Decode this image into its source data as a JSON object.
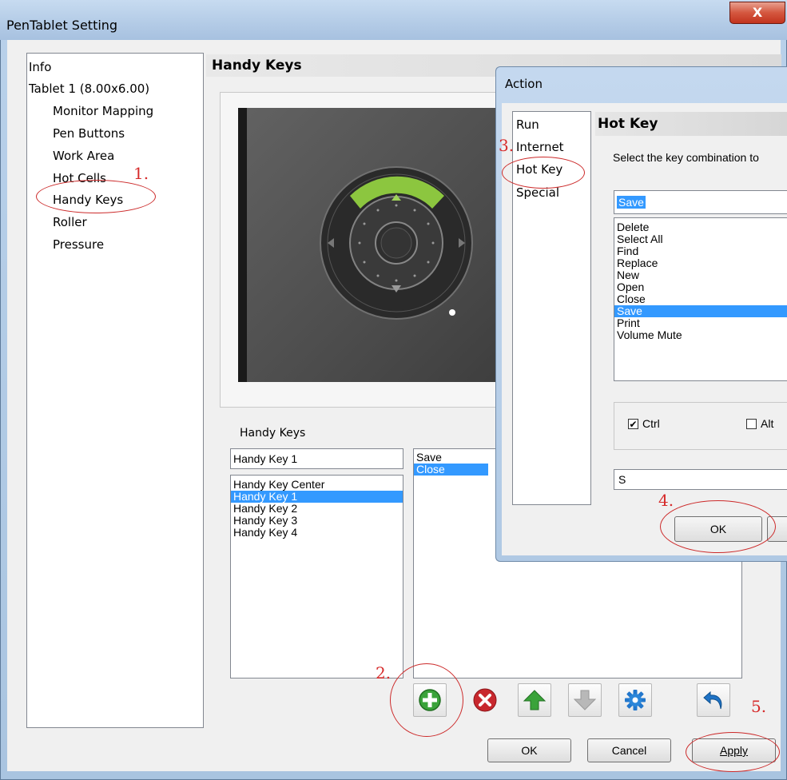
{
  "window": {
    "title": "PenTablet Setting",
    "close_glyph": "X"
  },
  "tree": {
    "items": [
      {
        "label": "Info",
        "indent": 0
      },
      {
        "label": "Tablet 1 (8.00x6.00)",
        "indent": 0
      },
      {
        "label": "Monitor Mapping",
        "indent": 1
      },
      {
        "label": "Pen Buttons",
        "indent": 1
      },
      {
        "label": "Work Area",
        "indent": 1
      },
      {
        "label": "Hot Cells",
        "indent": 1
      },
      {
        "label": "Handy Keys",
        "indent": 1
      },
      {
        "label": "Roller",
        "indent": 1
      },
      {
        "label": "Pressure",
        "indent": 1
      }
    ]
  },
  "panel": {
    "title": "Handy Keys",
    "list_caption": "Handy Keys",
    "edit_value": "Handy Key 1",
    "keys": [
      "Handy Key Center",
      "Handy Key 1",
      "Handy Key 2",
      "Handy Key 3",
      "Handy Key 4"
    ],
    "selected_key": 1,
    "actions": [
      "Save",
      "Close"
    ],
    "selected_action": 1
  },
  "toolbar": {
    "add_icon": "add-icon",
    "delete_icon": "delete-icon",
    "up_icon": "arrow-up-icon",
    "down_icon": "arrow-down-icon",
    "settings_icon": "gear-icon",
    "undo_icon": "undo-icon"
  },
  "footer": {
    "ok_label": "OK",
    "cancel_label": "Cancel",
    "apply_label": "Apply"
  },
  "annotations": {
    "step1": "1.",
    "step2": "2.",
    "step3": "3.",
    "step4": "4.",
    "step5": "5."
  },
  "action_dialog": {
    "title": "Action",
    "list": [
      "Run",
      "Internet",
      "Hot Key",
      "Special"
    ],
    "header": "Hot Key",
    "instruction": "Select the key combination to",
    "combo_value": "Save",
    "key_list": [
      "Delete",
      "Select All",
      "Find",
      "Replace",
      "New",
      "Open",
      "Close",
      "Save",
      "Print",
      "Volume Mute"
    ],
    "selected_key_item": 7,
    "ctrl_label": "Ctrl",
    "ctrl_checked": true,
    "alt_label": "Alt",
    "alt_checked": false,
    "key_value": "S",
    "ok_label": "OK"
  },
  "colors": {
    "selection": "#3399ff",
    "annotation": "#d62b2b",
    "title_bar": "#b9d1ea",
    "ring_highlight": "#8cc63f"
  }
}
